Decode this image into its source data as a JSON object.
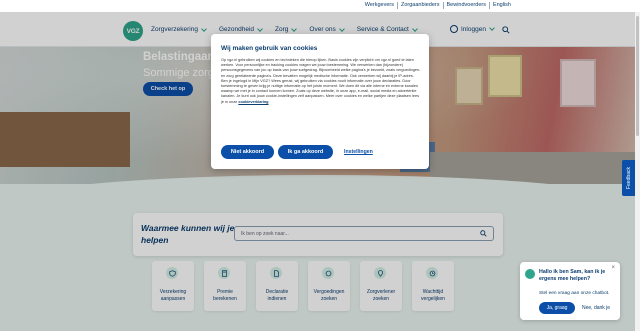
{
  "util_links": [
    "Werkgevers",
    "Zorgaanbieders",
    "Bewindvoerders",
    "English"
  ],
  "nav": {
    "logo": "VGZ",
    "items": [
      "Zorgverzekering",
      "Gezondheid",
      "Zorg",
      "Over ons",
      "Service & Contact"
    ],
    "login": "Inloggen"
  },
  "hero": {
    "title": "Belastingaan",
    "subtitle": "Sommige zorg",
    "button": "Check het op"
  },
  "search": {
    "title": "Waarmee kunnen wij je helpen",
    "placeholder": "Ik ben op zoek naar..."
  },
  "tiles": [
    {
      "label": "Verzekering aanpassen",
      "icon": "shield-icon"
    },
    {
      "label": "Premie berekenen",
      "icon": "calculator-icon"
    },
    {
      "label": "Declaratie indienen",
      "icon": "document-icon"
    },
    {
      "label": "Vergoedingen zoeken",
      "icon": "coins-icon"
    },
    {
      "label": "Zorgverlener zoeken",
      "icon": "location-icon"
    },
    {
      "label": "Wachttijd vergelijken",
      "icon": "clock-icon"
    }
  ],
  "cookie": {
    "title": "Wij maken gebruik van cookies",
    "body": "Op vgz.nl gebruiken wij cookies en technieken die hierop lijken. Basis cookies zijn verplicht om vgz.nl goed te laten werken. Voor persoonlijke en tracking cookies vragen we jouw toestemming. We verwerken dan (bijzondere) persoonsgegevens van jou op basis van jouw surfgedrag. Bijvoorbeeld welke pagina's je bezoekt, zoals vergoedingen- en zorg gerelateerde pagina's. Deze bevatten mogelijk medische informatie. Ook verwerken wij daarbij je IP-adres. Ben je ingelogd in Mijn VGZ? Wees gerust, wij gebruiken via cookies nooit informatie over jouw declaraties. Door toestemming te geven krijg je nuttige informatie op het juiste moment. We doen dit via alle interne en externe kanalen waarop we met je in contact kunnen komen. Zoals op deze website, in onze app, e-mail, social media en advertentie kanalen. Je kunt ook jouw cookie-instellingen zelf aanpassen. Meer over cookies en welke partijen deze plaatsen lees je in onze",
    "link": "cookieverklaring",
    "btn_ok": "Niet akkoord",
    "btn_agree": "Ik ga akkoord",
    "settings": "Instellingen"
  },
  "feedback": "Feedback",
  "chat": {
    "title": "Hallo ik ben Sam, kan ik je ergens mee helpen?",
    "question": "Stel een vraag aan onze chatbot.",
    "yes": "Ja, graag",
    "no": "Nee, dank je",
    "close": "×"
  },
  "colors": {
    "brand": "#2ea58c",
    "primary": "#0b4fa8",
    "navy": "#0b3d6e",
    "background": "#eaf4f1"
  }
}
